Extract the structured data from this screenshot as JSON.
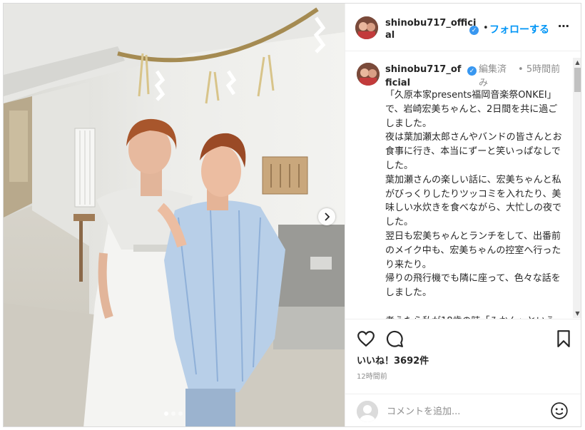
{
  "post": {
    "username": "shinobu717_official",
    "follow_label": "フォローする",
    "header_separator": "•",
    "edited_label": "編集済み",
    "time_separator": "•",
    "posted_ago": "5時間前",
    "caption": "「久原本家presents福岡音楽祭ONKEI」で、岩崎宏美ちゃんと、2日間を共に過ごしました。\n夜は葉加瀬太郎さんやバンドの皆さんとお食事に行き、本当にずーと笑いっぱなしでした。\n葉加瀬さんの楽しい話に、宏美ちゃんと私がびっくりしたりツッコミを入れたり、美味しい水炊きを食べながら、大忙しの夜でした。\n翌日も宏美ちゃんとランチをして、出番前のメイク中も、宏美ちゃんの控室へ行ったり来たり。\n帰りの飛行機でも隣に座って、色々な話をしました。\n\n考えたら私が18歳の時「みかん」という歌でCDデビュー(その頃はレコード",
    "likes_label": "いいね！3692件",
    "posted_time": "12時間前",
    "comment_placeholder": "コメントを追加...",
    "carousel": {
      "total": 3,
      "current": 1
    }
  },
  "icons": {
    "more": "more-options-icon",
    "verified": "verified-badge-icon",
    "like": "heart-icon",
    "comment": "comment-icon",
    "save": "bookmark-icon",
    "emoji": "emoji-icon",
    "next": "chevron-right-icon"
  },
  "colors": {
    "accent": "#0095f6",
    "verified": "#3897f0",
    "muted": "#8e8e8e",
    "text": "#262626"
  }
}
